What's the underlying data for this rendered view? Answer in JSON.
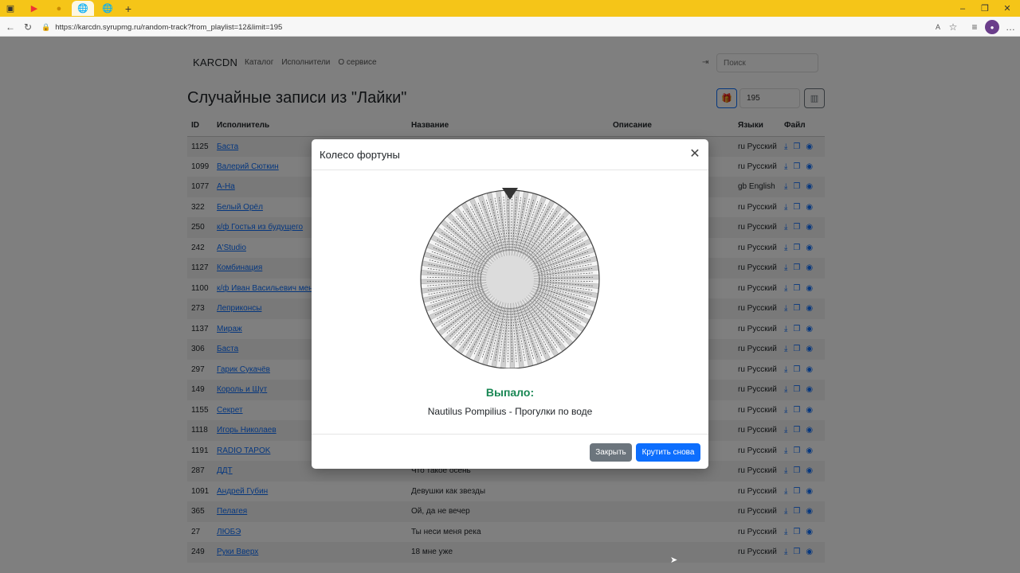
{
  "browser": {
    "url": "https://karcdn.syrupmg.ru/random-track?from_playlist=12&limit=195",
    "window_controls": [
      "–",
      "❐",
      "✕"
    ]
  },
  "nav": {
    "brand": "KARCDN",
    "links": [
      "Каталог",
      "Исполнители",
      "О сервисе"
    ],
    "search_placeholder": "Поиск"
  },
  "page": {
    "title": "Случайные записи из \"Лайки\"",
    "limit_value": "195"
  },
  "table": {
    "headers": [
      "ID",
      "Исполнитель",
      "Название",
      "Описание",
      "Языки",
      "Файл"
    ],
    "rows": [
      {
        "id": "1125",
        "artist": "Баста",
        "title": "",
        "lang": "ru Русский"
      },
      {
        "id": "1099",
        "artist": "Валерий Сюткин",
        "title": "",
        "lang": "ru Русский"
      },
      {
        "id": "1077",
        "artist": "A-Ha",
        "title": "",
        "lang": "gb English"
      },
      {
        "id": "322",
        "artist": "Белый Орёл",
        "title": "",
        "lang": "ru Русский"
      },
      {
        "id": "250",
        "artist": "к/ф Гостья из будущего",
        "title": "",
        "lang": "ru Русский"
      },
      {
        "id": "242",
        "artist": "A'Studio",
        "title": "",
        "lang": "ru Русский"
      },
      {
        "id": "1127",
        "artist": "Комбинация",
        "title": "",
        "lang": "ru Русский"
      },
      {
        "id": "1100",
        "artist": "к/ф Иван Васильевич мен",
        "title": "",
        "lang": "ru Русский"
      },
      {
        "id": "273",
        "artist": "Леприконсы",
        "title": "",
        "lang": "ru Русский"
      },
      {
        "id": "1137",
        "artist": "Мираж",
        "title": "",
        "lang": "ru Русский"
      },
      {
        "id": "306",
        "artist": "Баста",
        "title": "",
        "lang": "ru Русский"
      },
      {
        "id": "297",
        "artist": "Гарик Сукачёв",
        "title": "",
        "lang": "ru Русский"
      },
      {
        "id": "149",
        "artist": "Король и Шут",
        "title": "",
        "lang": "ru Русский"
      },
      {
        "id": "1155",
        "artist": "Секрет",
        "title": "",
        "lang": "ru Русский"
      },
      {
        "id": "1118",
        "artist": "Игорь Николаев",
        "title": "",
        "lang": "ru Русский"
      },
      {
        "id": "1191",
        "artist": "RADIO TAPOK",
        "title": "",
        "lang": "ru Русский"
      },
      {
        "id": "287",
        "artist": "ДДТ",
        "title": "Что такое осень",
        "lang": "ru Русский"
      },
      {
        "id": "1091",
        "artist": "Андрей Губин",
        "title": "Девушки как звезды",
        "lang": "ru Русский"
      },
      {
        "id": "365",
        "artist": "Пелагея",
        "title": "Ой, да не вечер",
        "lang": "ru Русский"
      },
      {
        "id": "27",
        "artist": "ЛЮБЭ",
        "title": "Ты неси меня река",
        "lang": "ru Русский"
      },
      {
        "id": "249",
        "artist": "Руки Вверх",
        "title": "18 мне уже",
        "lang": "ru Русский"
      }
    ]
  },
  "modal": {
    "title": "Колесо фортуны",
    "result_label": "Выпало:",
    "result_value": "Nautilus Pompilius - Прогулки по воде",
    "close_label": "Закрыть",
    "spin_label": "Крутить снова"
  }
}
